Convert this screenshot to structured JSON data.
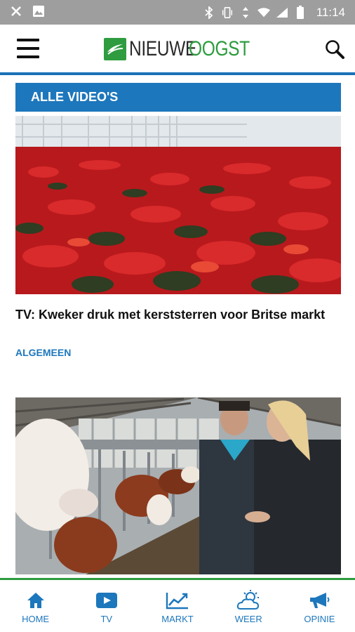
{
  "status_bar": {
    "time": "11:14",
    "left_icons": [
      "missed-call-icon",
      "image-icon"
    ],
    "right_icons": [
      "bluetooth-icon",
      "vibrate-icon",
      "data-arrows-icon",
      "wifi-icon",
      "signal-icon",
      "battery-icon"
    ]
  },
  "app_bar": {
    "logo_part1": "NIEUWE",
    "logo_part2": "OOGST",
    "menu_icon": "hamburger-menu-icon",
    "search_icon": "search-icon"
  },
  "section": {
    "title": "ALLE VIDEO'S"
  },
  "articles": [
    {
      "title": "TV: Kweker druk met kerststerren voor Britse markt",
      "category": "ALGEMEEN",
      "image": "poinsettia-greenhouse-photo"
    },
    {
      "image": "cows-in-barn-with-farmers-photo"
    }
  ],
  "bottom_nav": {
    "home": "HOME",
    "tv": "TV",
    "markt": "MARKT",
    "weer": "WEER",
    "opinie": "OPINIE"
  },
  "colors": {
    "brand_green": "#2e9c3f",
    "brand_blue": "#1d77bc",
    "status_bar": "#9e9e9e"
  }
}
